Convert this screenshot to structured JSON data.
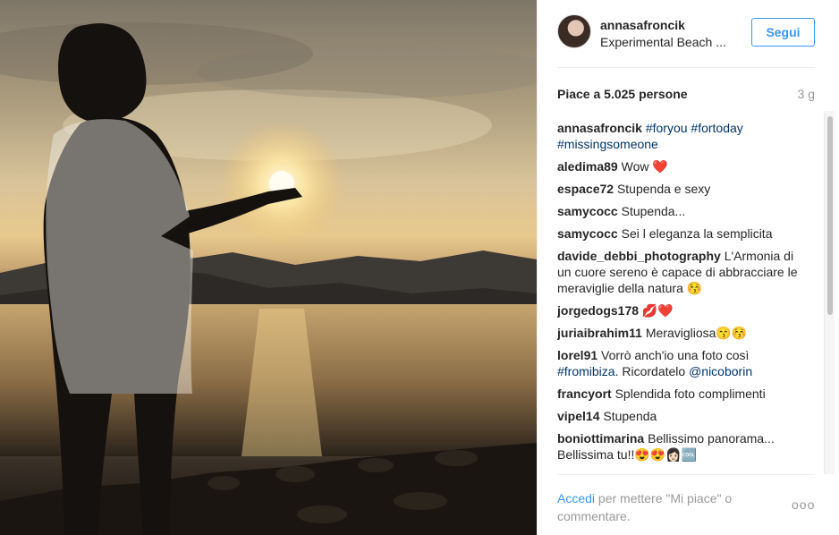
{
  "post": {
    "username": "annasafroncik",
    "location": "Experimental Beach ...",
    "follow_label": "Segui",
    "likes": "Piace a 5.025 persone",
    "time": "3 g"
  },
  "caption": {
    "user": "annasafroncik",
    "tags": [
      "#foryou",
      "#fortoday",
      "#missingsomeone"
    ]
  },
  "comments": [
    {
      "user": "aledima89",
      "text": "Wow ❤️"
    },
    {
      "user": "espace72",
      "text": "Stupenda e sexy"
    },
    {
      "user": "samycocc",
      "text": "Stupenda..."
    },
    {
      "user": "samycocc",
      "text": "Sei l eleganza la semplicita"
    },
    {
      "user": "davide_debbi_photography",
      "text": "L'Armonia di un cuore sereno è capace di abbracciare le meraviglie della natura 😚"
    },
    {
      "user": "jorgedogs178",
      "text": "💋❤️"
    },
    {
      "user": "juriaibrahim11",
      "text": "Meravigliosa😙😚"
    },
    {
      "user": "lorel91",
      "text": "Vorrò anch'io una foto così",
      "tag": "#fromibiza",
      "text2": ". Ricordatelo",
      "mention": "@nicoborin"
    },
    {
      "user": "francyort",
      "text": "Splendida foto complimenti"
    },
    {
      "user": "vipel14",
      "text": "Stupenda"
    },
    {
      "user": "boniottimarina",
      "text": "Bellissimo panorama... Bellissima tu!!😍😍👩🏻🆒"
    }
  ],
  "footer": {
    "login_link": "Accedi",
    "login_text": " per mettere \"Mi piace\" o commentare.",
    "more_label": "ooo"
  },
  "colors": {
    "link_blue": "#3897f0",
    "hashtag_blue": "#003569",
    "muted": "#999999"
  }
}
